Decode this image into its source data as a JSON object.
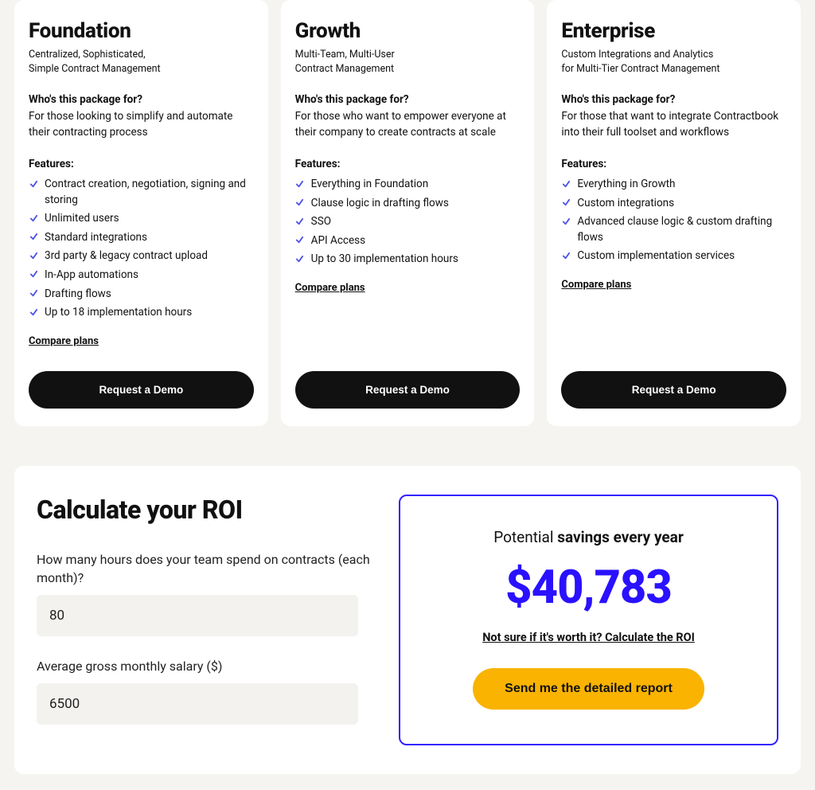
{
  "plans": [
    {
      "title": "Foundation",
      "sub_line1": "Centralized, Sophisticated,",
      "sub_line2": "Simple Contract Management",
      "who_title": "Who's this package for?",
      "who_text": "For those looking to simplify and automate their contracting process",
      "features_title": "Features:",
      "features": [
        "Contract creation, negotiation, signing and storing",
        "Unlimited users",
        "Standard integrations",
        "3rd party & legacy contract upload",
        "In-App automations",
        "Drafting flows",
        "Up to 18 implementation hours"
      ],
      "compare_label": "Compare plans",
      "cta_label": "Request a Demo"
    },
    {
      "title": "Growth",
      "sub_line1": "Multi-Team, Multi-User",
      "sub_line2": "Contract Management",
      "who_title": "Who's this package for?",
      "who_text": "For those who want to empower everyone at their company to create contracts at scale",
      "features_title": "Features:",
      "features": [
        "Everything in Foundation",
        "Clause logic in drafting flows",
        "SSO",
        "API Access",
        "Up to 30 implementation hours"
      ],
      "compare_label": "Compare plans",
      "cta_label": "Request a Demo"
    },
    {
      "title": "Enterprise",
      "sub_line1": "Custom Integrations and Analytics",
      "sub_line2": "for Multi-Tier Contract Management",
      "who_title": "Who's this package for?",
      "who_text": "For those that want to integrate Contractbook into their full toolset and workflows",
      "features_title": "Features:",
      "features": [
        "Everything in Growth",
        "Custom integrations",
        "Advanced clause logic & custom drafting flows",
        "Custom implementation services"
      ],
      "compare_label": "Compare plans",
      "cta_label": "Request a Demo"
    }
  ],
  "roi": {
    "title": "Calculate your ROI",
    "hours_label": "How many hours does your team spend on contracts (each month)?",
    "hours_value": "80",
    "salary_label": "Average gross monthly salary ($)",
    "salary_value": "6500",
    "savings_prefix": "Potential",
    "savings_suffix": "savings every year",
    "savings_amount": "$40,783",
    "note": "Not sure if it's worth it? Calculate the ROI",
    "report_cta": "Send me the detailed report"
  }
}
